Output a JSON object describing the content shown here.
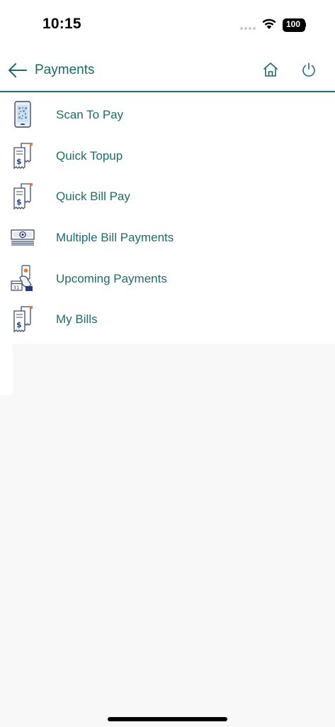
{
  "status_bar": {
    "time": "10:15",
    "battery": "100"
  },
  "header": {
    "title": "Payments"
  },
  "menu": {
    "items": [
      {
        "label": "Scan To Pay"
      },
      {
        "label": "Quick Topup"
      },
      {
        "label": "Quick Bill Pay"
      },
      {
        "label": "Multiple Bill Payments"
      },
      {
        "label": "Upcoming Payments"
      },
      {
        "label": "My Bills"
      }
    ]
  },
  "colors": {
    "accent": "#1e6b6b",
    "divider": "#1f6f6b",
    "background": "#f8f8f8"
  },
  "icons": [
    "back-arrow-icon",
    "home-icon",
    "power-icon",
    "phone-qr-icon",
    "bill-receipt-icon",
    "cash-stack-icon",
    "calendar-payment-icon"
  ]
}
